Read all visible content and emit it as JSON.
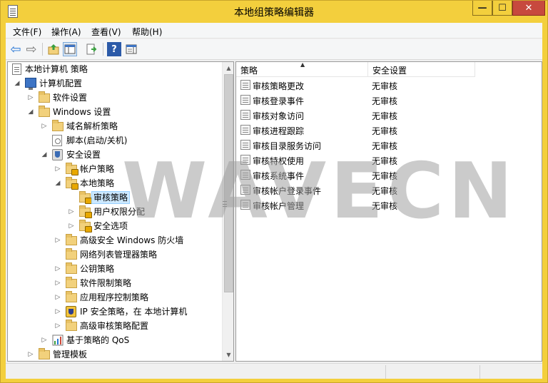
{
  "window": {
    "title": "本地组策略编辑器",
    "min_symbol": "—",
    "max_symbol": "☐",
    "close_symbol": "✕"
  },
  "menu": [
    "文件(F)",
    "操作(A)",
    "查看(V)",
    "帮助(H)"
  ],
  "toolbar": {
    "back": "⇦",
    "forward": "⇨",
    "help": "?"
  },
  "tree": [
    {
      "label": "本地计算机 策略",
      "icon": "doc-icon"
    },
    {
      "label": "计算机配置",
      "icon": "computer-icon",
      "arrow": "◢"
    },
    {
      "label": "软件设置",
      "icon": "folder-icon",
      "arrow": "▷"
    },
    {
      "label": "Windows 设置",
      "icon": "folder-icon",
      "arrow": "◢"
    },
    {
      "label": "域名解析策略",
      "icon": "folder-icon",
      "arrow": "▷"
    },
    {
      "label": "脚本(启动/关机)",
      "icon": "script-icon"
    },
    {
      "label": "安全设置",
      "icon": "security-settings-icon",
      "arrow": "◢"
    },
    {
      "label": "帐户策略",
      "icon": "locked-folder-icon",
      "arrow": "▷"
    },
    {
      "label": "本地策略",
      "icon": "locked-folder-icon",
      "arrow": "◢"
    },
    {
      "label": "审核策略",
      "icon": "locked-folder-icon"
    },
    {
      "label": "用户权限分配",
      "icon": "locked-folder-icon",
      "arrow": "▷"
    },
    {
      "label": "安全选项",
      "icon": "locked-folder-icon",
      "arrow": "▷"
    },
    {
      "label": "高级安全 Windows 防火墙",
      "icon": "folder-icon",
      "arrow": "▷"
    },
    {
      "label": "网络列表管理器策略",
      "icon": "folder-icon"
    },
    {
      "label": "公钥策略",
      "icon": "folder-icon",
      "arrow": "▷"
    },
    {
      "label": "软件限制策略",
      "icon": "folder-icon",
      "arrow": "▷"
    },
    {
      "label": "应用程序控制策略",
      "icon": "folder-icon",
      "arrow": "▷"
    },
    {
      "label": "IP 安全策略，在 本地计算机",
      "icon": "ip-security-icon",
      "arrow": "▷"
    },
    {
      "label": "高级审核策略配置",
      "icon": "folder-icon",
      "arrow": "▷"
    },
    {
      "label": "基于策略的 QoS",
      "icon": "chart-icon",
      "arrow": "▷"
    },
    {
      "label": "管理模板",
      "icon": "folder-icon",
      "arrow": "▷"
    }
  ],
  "scroll": {
    "up": "▲",
    "down": "▼"
  },
  "list": {
    "headers": {
      "policy": "策略",
      "setting": "安全设置",
      "sort_indicator": "▲"
    },
    "rows": [
      {
        "name": "审核策略更改",
        "value": "无审核"
      },
      {
        "name": "审核登录事件",
        "value": "无审核"
      },
      {
        "name": "审核对象访问",
        "value": "无审核"
      },
      {
        "name": "审核进程跟踪",
        "value": "无审核"
      },
      {
        "name": "审核目录服务访问",
        "value": "无审核"
      },
      {
        "name": "审核特权使用",
        "value": "无审核"
      },
      {
        "name": "审核系统事件",
        "value": "无审核"
      },
      {
        "name": "审核帐户登录事件",
        "value": "无审核"
      },
      {
        "name": "审核帐户管理",
        "value": "无审核"
      }
    ]
  },
  "watermark": "WAVECN",
  "colors": {
    "title_bar": "#f3cf3d",
    "close_button": "#c7493e",
    "selection": "#cce8ff"
  }
}
